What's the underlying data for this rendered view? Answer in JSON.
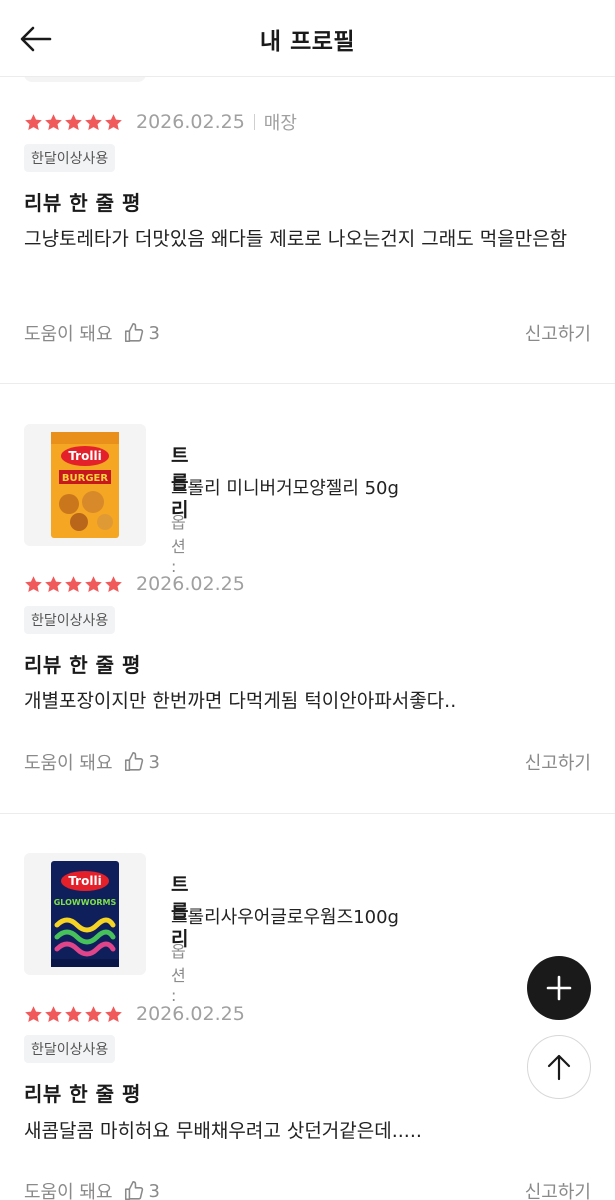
{
  "header": {
    "title": "내 프로필"
  },
  "colors": {
    "star": "#f05a5a",
    "fab": "#1a1a1a"
  },
  "reviews": [
    {
      "rating": 5,
      "date": "2026.02.25",
      "channel": "매장",
      "badge": "한달이상사용",
      "title": "리뷰 한 줄 평",
      "text": "그냥토레타가 더맛있음 왜다들 제로로 나오는건지 그래도 먹을만은함",
      "helpful_label": "도움이 돼요",
      "helpful_count": "3",
      "report_label": "신고하기"
    },
    {
      "product": {
        "brand": "트롤리",
        "name": "트롤리 미니버거모양젤리 50g",
        "option": "옵션 :",
        "package_text": "Trolli",
        "package_sub": "BURGER"
      },
      "rating": 5,
      "date": "2026.02.25",
      "badge": "한달이상사용",
      "title": "리뷰 한 줄 평",
      "text": "개별포장이지만 한번까면 다먹게됨 턱이안아파서좋다..",
      "helpful_label": "도움이 돼요",
      "helpful_count": "3",
      "report_label": "신고하기"
    },
    {
      "product": {
        "brand": "트롤리",
        "name": "트롤리사우어글로우웜즈100g",
        "option": "옵션 :",
        "package_text": "Trolli",
        "package_sub": "GLOWWORMS"
      },
      "rating": 5,
      "date": "2026.02.25",
      "badge": "한달이상사용",
      "title": "리뷰 한 줄 평",
      "text": "새콤달콤 마히허요 무배채우려고 삿던거같은데.....",
      "helpful_label": "도움이 돼요",
      "helpful_count": "3",
      "report_label": "신고하기"
    }
  ],
  "icons": {
    "back": "arrow-left-icon",
    "add": "plus-icon",
    "top": "arrow-up-icon",
    "like": "thumbs-up-icon",
    "star": "star-icon"
  }
}
